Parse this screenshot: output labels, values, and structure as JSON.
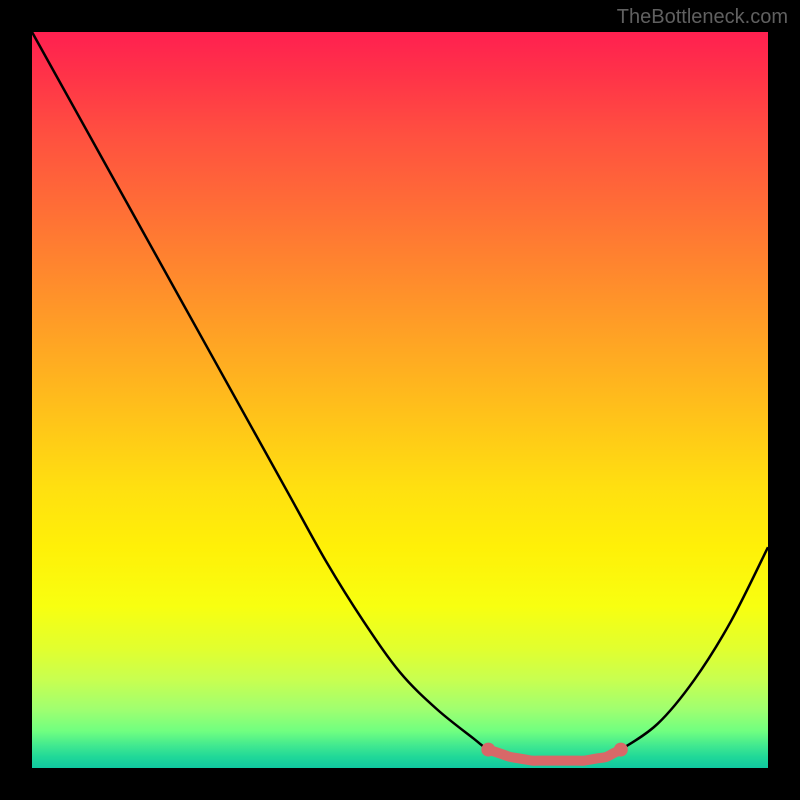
{
  "watermark": "TheBottleneck.com",
  "chart_data": {
    "type": "line",
    "title": "",
    "xlabel": "",
    "ylabel": "",
    "xlim": [
      0,
      100
    ],
    "ylim": [
      0,
      100
    ],
    "series": [
      {
        "name": "curve",
        "x": [
          0,
          5,
          10,
          15,
          20,
          25,
          30,
          35,
          40,
          45,
          50,
          55,
          60,
          62,
          65,
          68,
          70,
          72,
          75,
          78,
          80,
          85,
          90,
          95,
          100
        ],
        "y": [
          100,
          91,
          82,
          73,
          64,
          55,
          46,
          37,
          28,
          20,
          13,
          8,
          4,
          2.5,
          1.5,
          1,
          1,
          1,
          1,
          1.5,
          2.5,
          6,
          12,
          20,
          30
        ]
      }
    ],
    "highlight_segment": {
      "x_start": 62,
      "x_end": 80,
      "color": "#d86868",
      "description": "optimal zone near curve minimum"
    }
  }
}
